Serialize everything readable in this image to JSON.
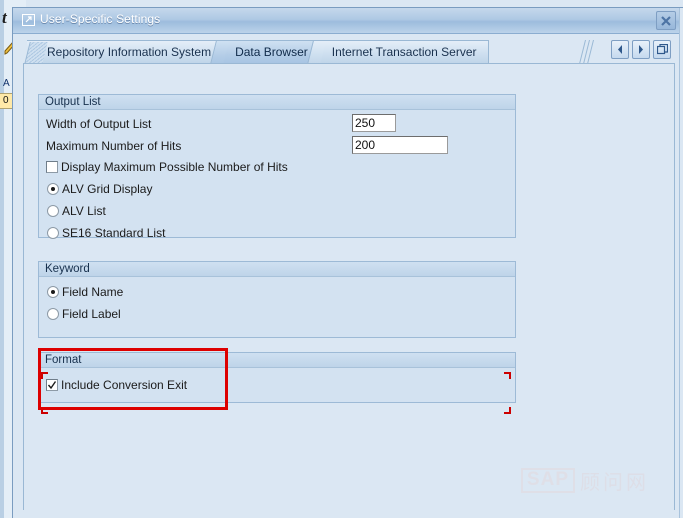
{
  "window": {
    "title": "User-Specific Settings",
    "title_icon": "window-restore-icon",
    "close_label": "close-icon"
  },
  "tabstrip": {
    "tabs": [
      {
        "label": "Repository Information System",
        "active": false
      },
      {
        "label": "Data Browser",
        "active": true
      },
      {
        "label": "Internet Transaction Server",
        "active": false
      }
    ],
    "nav": {
      "prev": "scroll-left-icon",
      "next": "scroll-right-icon",
      "list": "tab-list-icon"
    }
  },
  "groups": {
    "output_list": {
      "title": "Output List",
      "width_label": "Width of Output List",
      "width_value": "250",
      "max_hits_label": "Maximum Number of Hits",
      "max_hits_value": "200",
      "display_max_hits_label": "Display Maximum Possible Number of Hits",
      "display_max_hits_checked": false,
      "display_mode_options": [
        {
          "label": "ALV Grid Display",
          "selected": true
        },
        {
          "label": "ALV List",
          "selected": false
        },
        {
          "label": "SE16 Standard List",
          "selected": false
        }
      ]
    },
    "keyword": {
      "title": "Keyword",
      "options": [
        {
          "label": "Field Name",
          "selected": true
        },
        {
          "label": "Field Label",
          "selected": false
        }
      ]
    },
    "format": {
      "title": "Format",
      "conversion_exit_label": "Include Conversion Exit",
      "conversion_exit_checked": true
    }
  },
  "watermark": {
    "brand": "SAP",
    "site": "顾问网"
  },
  "background": {
    "title_initial": "t",
    "letter": "A",
    "field_value": "0"
  },
  "colors": {
    "window_bg": "#dbe7f3",
    "group_bg": "#d3e2f1",
    "titlebar": "#9dbcdd",
    "border": "#9ab8d4",
    "highlight_red": "#dd0000",
    "focus_red": "#cc0000",
    "text": "#1b1b1b"
  }
}
